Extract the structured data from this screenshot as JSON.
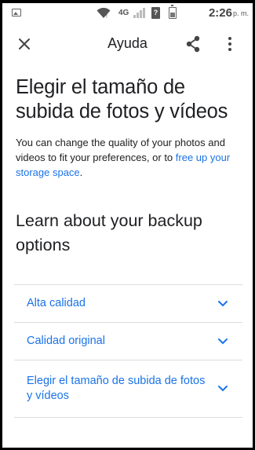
{
  "status_bar": {
    "network": "4G",
    "sim_label": "?",
    "time": "2:26",
    "ampm": "p. m."
  },
  "app_bar": {
    "title": "Ayuda",
    "icons": [
      "close-icon",
      "share-icon",
      "more-vert-icon"
    ]
  },
  "article": {
    "title": "Elegir el tamaño de subida de fotos y vídeos",
    "intro_text": "You can change the quality of your photos and videos to fit your preferences, or to ",
    "intro_link": "free up your storage space",
    "intro_end": ".",
    "section_title": "Learn about your backup options"
  },
  "accordion": {
    "items": [
      {
        "label": "Alta calidad"
      },
      {
        "label": "Calidad original"
      },
      {
        "label": "Elegir el tamaño de subida de fotos y vídeos"
      }
    ]
  },
  "colors": {
    "link": "#1a73e8",
    "text": "#202124",
    "divider": "#dadce0"
  }
}
